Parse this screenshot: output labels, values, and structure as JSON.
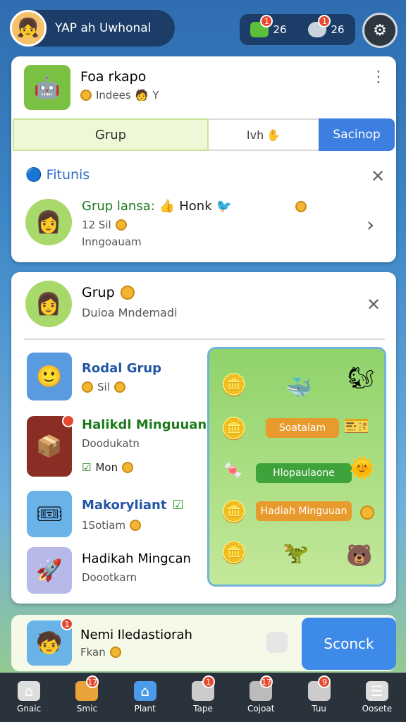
{
  "profile": {
    "name": "YAP ah Uwhonal"
  },
  "resources": [
    {
      "value": "26",
      "badge": "1",
      "color": "#5bbf3a"
    },
    {
      "value": "26",
      "badge": "1",
      "color": "#c9d3dc"
    }
  ],
  "top_card": {
    "title": "Foa rkapo",
    "subtitle": "Indees",
    "subtitle_suffix": "Y"
  },
  "tabs": {
    "grup": "Grup",
    "mid": "Ivh",
    "search": "Sacinop"
  },
  "friends": {
    "header": "Fitunis",
    "item_title": "Grup lansa:",
    "item_title_2": "Honk",
    "item_line2": "12 Sil",
    "item_line3": "Inngoauam"
  },
  "group_card": {
    "title": "Grup",
    "subtitle": "Duioa Mndemadi"
  },
  "list": [
    {
      "title": "Rodal Grup",
      "line2": "Sil",
      "title_color": "#2456a6"
    },
    {
      "title": "Halikdl Minguuan",
      "line2": "Doodukatn",
      "line3": "Mon",
      "title_color": "#1d7a1d"
    },
    {
      "title": "Makoryliant",
      "line2": "1Sotiam",
      "title_color": "#2456a6"
    },
    {
      "title": "Hadikah Mingcan",
      "line2": "Doootkarn",
      "title_color": "#222"
    }
  ],
  "panel": {
    "ribbon1": "Soatalam",
    "ribbon2": "Hlopaulaone",
    "ribbon3": "Hadiah Minguuan"
  },
  "bottom": {
    "title": "Nemi Iledastiorah",
    "subtitle": "Fkan",
    "badge": "1",
    "search_label": "Sconck"
  },
  "nav": [
    {
      "label": "Gnaic",
      "badge": "",
      "icon": "home-icon"
    },
    {
      "label": "Smic",
      "badge": "17",
      "icon": "shop-icon"
    },
    {
      "label": "Plant",
      "badge": "",
      "icon": "house-icon"
    },
    {
      "label": "Tape",
      "badge": "1",
      "icon": "chat-icon"
    },
    {
      "label": "Cojoat",
      "badge": "17",
      "icon": "gift-icon"
    },
    {
      "label": "Tuu",
      "badge": "9",
      "icon": "mail-icon"
    },
    {
      "label": "Oosete",
      "badge": "",
      "icon": "menu-icon"
    }
  ],
  "colors": {
    "accent": "#3d7fe0",
    "nav_bg": "#2a323c",
    "topbar": "#1c3d68"
  }
}
